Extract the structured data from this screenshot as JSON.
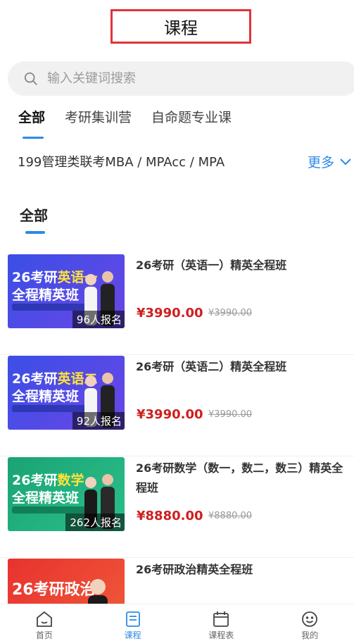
{
  "header": {
    "title": "课程"
  },
  "search": {
    "placeholder": "输入关键词搜索"
  },
  "tabs": [
    {
      "label": "全部",
      "active": true
    },
    {
      "label": "考研集训营",
      "active": false
    },
    {
      "label": "自命题专业课",
      "active": false
    }
  ],
  "category": {
    "text": "199管理类联考MBA / MPAcc / MPA",
    "more_label": "更多"
  },
  "section": {
    "title": "全部"
  },
  "colors": {
    "accent": "#2d8ae6",
    "price": "#cf1e1e",
    "highlight": "#e0343a"
  },
  "courses": [
    {
      "title": "26考研（英语一）精英全程班",
      "price": "¥3990.00",
      "old_price": "¥3990.00",
      "enrolled": "96人报名",
      "thumb": {
        "line1_prefix": "26考研",
        "line1_highlight": "英语一",
        "line2": "全程精英班",
        "bg": "#3b55e8"
      }
    },
    {
      "title": "26考研（英语二）精英全程班",
      "price": "¥3990.00",
      "old_price": "¥3990.00",
      "enrolled": "92人报名",
      "thumb": {
        "line1_prefix": "26考研",
        "line1_highlight": "英语二",
        "line2": "全程精英班",
        "bg": "#3b55e8"
      }
    },
    {
      "title": "26考研数学（数一，数二，数三）精英全程班",
      "price": "¥8880.00",
      "old_price": "¥8880.00",
      "enrolled": "262人报名",
      "thumb": {
        "line1_prefix": "26考研",
        "line1_highlight": "数学",
        "line2": "全程精英班",
        "bg": "#1fa67a"
      }
    },
    {
      "title": "26考研政治精英全程班",
      "price": "",
      "old_price": "",
      "enrolled": "",
      "thumb": {
        "line1_prefix": "26考研政治",
        "line1_highlight": "",
        "line2": "",
        "bg": "#e8322e"
      }
    }
  ],
  "tabbar": [
    {
      "label": "首页",
      "icon": "home-icon",
      "active": false
    },
    {
      "label": "课程",
      "icon": "course-icon",
      "active": true
    },
    {
      "label": "课程表",
      "icon": "calendar-icon",
      "active": false
    },
    {
      "label": "我的",
      "icon": "smile-icon",
      "active": false
    }
  ]
}
